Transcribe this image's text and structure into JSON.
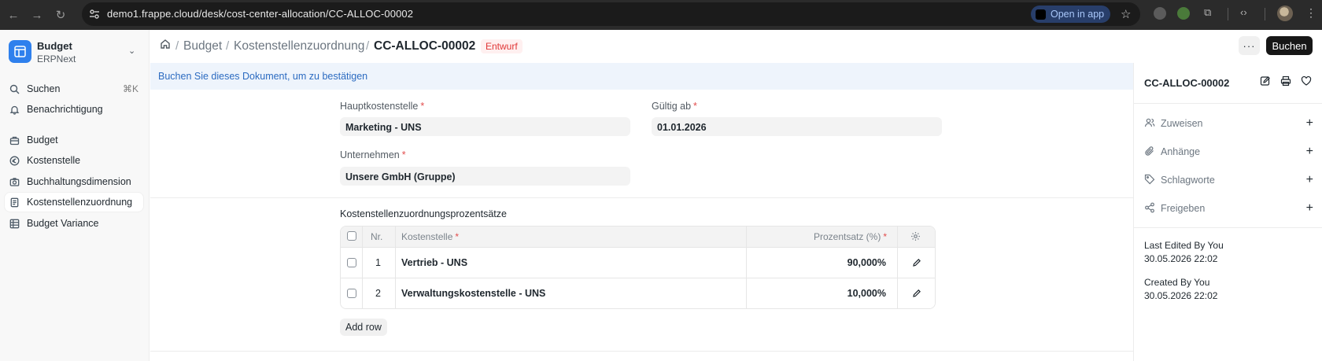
{
  "browser": {
    "url": "demo1.frappe.cloud/desk/cost-center-allocation/CC-ALLOC-00002",
    "open_in_app": "Open in app"
  },
  "sidebar": {
    "workspace_title": "Budget",
    "workspace_sub": "ERPNext",
    "search_label": "Suchen",
    "search_shortcut": "⌘K",
    "notifications_label": "Benachrichtigung",
    "items": [
      {
        "label": "Budget",
        "icon": "briefcase-icon"
      },
      {
        "label": "Kostenstelle",
        "icon": "currency-circle-icon"
      },
      {
        "label": "Buchhaltungsdimension",
        "icon": "camera-icon"
      },
      {
        "label": "Kostenstellenzuordnung",
        "icon": "document-icon",
        "active": true
      },
      {
        "label": "Budget Variance",
        "icon": "table-icon"
      }
    ]
  },
  "header": {
    "breadcrumbs": [
      "Budget",
      "Kostenstellenzuordnung"
    ],
    "doc_title": "CC-ALLOC-00002",
    "status": "Entwurf",
    "more_label": "···",
    "submit_label": "Buchen"
  },
  "message": "Buchen Sie dieses Dokument, um zu bestätigen",
  "form": {
    "main_cost_center_label": "Hauptkostenstelle",
    "main_cost_center_value": "Marketing - UNS",
    "valid_from_label": "Gültig ab",
    "valid_from_value": "01.01.2026",
    "company_label": "Unternehmen",
    "company_value": "Unsere GmbH (Gruppe)",
    "required_mark": "*"
  },
  "table": {
    "section_title": "Kostenstellenzuordnungsprozentsätze",
    "col_no": "Nr.",
    "col_cost_center": "Kostenstelle",
    "col_percentage": "Prozentsatz (%)",
    "rows": [
      {
        "no": "1",
        "cost_center": "Vertrieb - UNS",
        "percentage": "90,000%"
      },
      {
        "no": "2",
        "cost_center": "Verwaltungskostenstelle - UNS",
        "percentage": "10,000%"
      }
    ],
    "add_row_label": "Add row"
  },
  "right_panel": {
    "title": "CC-ALLOC-00002",
    "assign_label": "Zuweisen",
    "attachments_label": "Anhänge",
    "tags_label": "Schlagworte",
    "share_label": "Freigeben",
    "last_edited_label": "Last Edited By You",
    "last_edited_time": "30.05.2026 22:02",
    "created_label": "Created By You",
    "created_time": "30.05.2026 22:02"
  },
  "colors": {
    "accent_blue": "#2f80ed",
    "status_red": "#e03636",
    "message_bg": "#eef4fc",
    "message_text": "#2c6bc1"
  }
}
